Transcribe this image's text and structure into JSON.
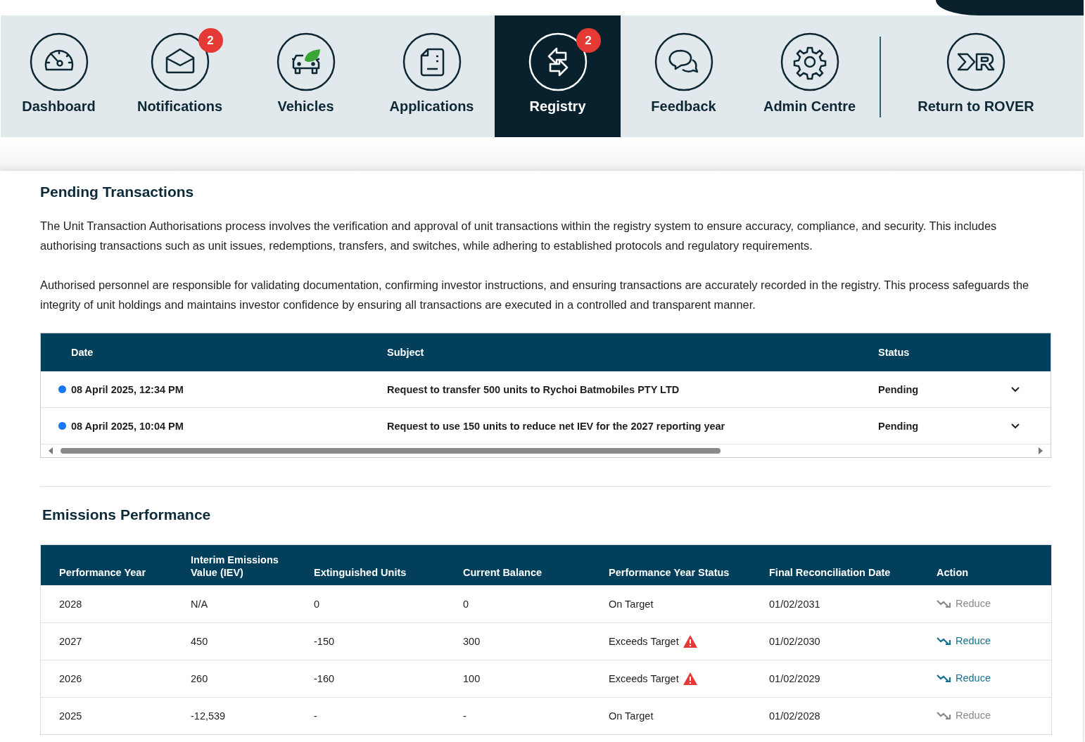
{
  "nav": {
    "items": [
      {
        "label": "Dashboard",
        "kind": "gauge",
        "selected": false
      },
      {
        "label": "Notifications",
        "kind": "envelope",
        "selected": false,
        "badge": "2"
      },
      {
        "label": "Vehicles",
        "kind": "vehicle",
        "selected": false
      },
      {
        "label": "Applications",
        "kind": "document",
        "selected": false
      },
      {
        "label": "Registry",
        "kind": "transfer",
        "selected": true,
        "badge": "2"
      },
      {
        "label": "Feedback",
        "kind": "chat",
        "selected": false
      },
      {
        "label": "Admin Centre",
        "kind": "gear",
        "selected": false
      },
      {
        "label": "Return to ROVER",
        "kind": "logo",
        "selected": false,
        "divider_before": true
      }
    ]
  },
  "pending": {
    "title": "Pending Transactions",
    "paragraphs": [
      "The Unit Transaction Authorisations process involves the verification and approval of unit transactions within the registry system to ensure accuracy, compliance, and security. This includes authorising transactions such as unit issues, redemptions, transfers, and switches, while adhering to established protocols and regulatory requirements.",
      "Authorised personnel are responsible for validating documentation, confirming investor instructions, and ensuring transactions are accurately recorded in the registry. This process safeguards the integrity of unit holdings and maintains investor confidence by ensuring all transactions are executed in a controlled and transparent manner."
    ],
    "table": {
      "columns": [
        "Date",
        "Subject",
        "Status"
      ],
      "rows": [
        {
          "unread": true,
          "date": "08 April 2025, 12:34 PM",
          "subject": "Request to transfer 500 units to Rychoi Batmobiles PTY LTD",
          "status": "Pending"
        },
        {
          "unread": true,
          "date": "08 April 2025, 10:04 PM",
          "subject": "Request to use 150 units to reduce net IEV for the 2027 reporting year",
          "status": "Pending"
        }
      ]
    }
  },
  "emissions": {
    "title": "Emissions Performance",
    "table": {
      "columns": [
        "Performance Year",
        "Interim Emissions Value (IEV)",
        "Extinguished Units",
        "Current Balance",
        "Performance Year Status",
        "Final Reconciliation Date",
        "Action"
      ],
      "rows": [
        {
          "year": "2028",
          "iev": "N/A",
          "extinguished": "0",
          "balance": "0",
          "status": "On Target",
          "warning": false,
          "date": "01/02/2031",
          "action": "Reduce",
          "disabled": true
        },
        {
          "year": "2027",
          "iev": "450",
          "extinguished": "-150",
          "balance": "300",
          "status": "Exceeds Target",
          "warning": true,
          "date": "01/02/2030",
          "action": "Reduce",
          "disabled": false
        },
        {
          "year": "2026",
          "iev": "260",
          "extinguished": "-160",
          "balance": "100",
          "status": "Exceeds Target",
          "warning": true,
          "date": "01/02/2029",
          "action": "Reduce",
          "disabled": false
        },
        {
          "year": "2025",
          "iev": "-12,539",
          "extinguished": "-",
          "balance": "-",
          "status": "On Target",
          "warning": false,
          "date": "01/02/2028",
          "action": "Reduce",
          "disabled": true
        }
      ]
    }
  }
}
